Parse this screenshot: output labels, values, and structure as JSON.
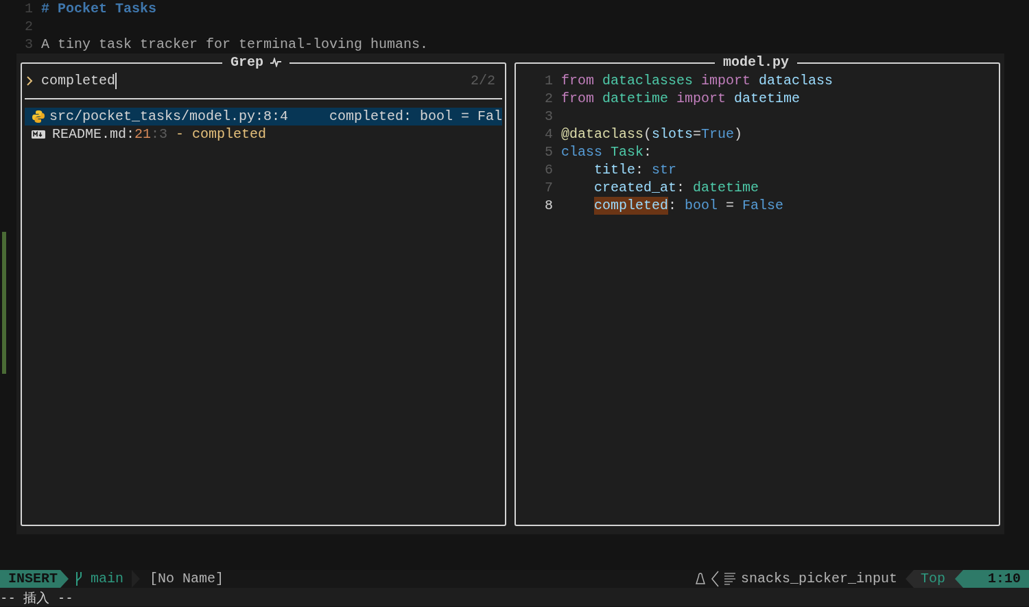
{
  "editor": {
    "lines": [
      {
        "number": "1",
        "tokens": [
          {
            "text": "# Pocket Tasks",
            "kind": "heading"
          }
        ]
      },
      {
        "number": "2"
      },
      {
        "number": "3",
        "tokens": [
          {
            "text": "A tiny task tracker for terminal-loving humans.",
            "kind": "plain"
          }
        ]
      }
    ]
  },
  "picker": {
    "title": "Grep",
    "query": "completed",
    "count": "2/2",
    "results": [
      {
        "kind": "python",
        "selected": true,
        "segments": [
          {
            "text": "src/pocket_tasks/model.py:8:4",
            "kind": "path"
          },
          {
            "text": "completed: bool = Fal",
            "kind": "match_text"
          }
        ]
      },
      {
        "kind": "markdown",
        "selected": false,
        "segments": [
          {
            "text": "README.md:",
            "kind": "path"
          },
          {
            "text": "21",
            "kind": "line"
          },
          {
            "text": ":3",
            "kind": "col"
          },
          {
            "text": " - completed",
            "kind": "preview"
          }
        ]
      }
    ]
  },
  "preview": {
    "title": "model.py",
    "lines": [
      {
        "number": "1",
        "current": false,
        "tokens": [
          {
            "text": "from ",
            "kind": "keyword"
          },
          {
            "text": "dataclasses ",
            "kind": "module"
          },
          {
            "text": "import ",
            "kind": "keyword"
          },
          {
            "text": "dataclass",
            "kind": "name"
          }
        ]
      },
      {
        "number": "2",
        "current": false,
        "tokens": [
          {
            "text": "from ",
            "kind": "keyword"
          },
          {
            "text": "datetime ",
            "kind": "module"
          },
          {
            "text": "import ",
            "kind": "keyword"
          },
          {
            "text": "datetime",
            "kind": "name"
          }
        ]
      },
      {
        "number": "3",
        "current": false
      },
      {
        "number": "4",
        "current": false,
        "tokens": [
          {
            "text": "@dataclass",
            "kind": "decorator"
          },
          {
            "text": "("
          },
          {
            "text": "slots",
            "kind": "name"
          },
          {
            "text": "="
          },
          {
            "text": "True",
            "kind": "constant"
          },
          {
            "text": ")"
          }
        ]
      },
      {
        "number": "5",
        "current": false,
        "tokens": [
          {
            "text": "class ",
            "kind": "constant"
          },
          {
            "text": "Task",
            "kind": "module"
          },
          {
            "text": ":"
          }
        ]
      },
      {
        "number": "6",
        "current": false,
        "tokens": [
          {
            "text": "    title",
            "kind": "name"
          },
          {
            "text": ": "
          },
          {
            "text": "str",
            "kind": "constant"
          }
        ]
      },
      {
        "number": "7",
        "current": false,
        "tokens": [
          {
            "text": "    created_at",
            "kind": "name"
          },
          {
            "text": ": "
          },
          {
            "text": "datetime",
            "kind": "module"
          }
        ]
      },
      {
        "number": "8",
        "current": true,
        "tokens": [
          {
            "text": "    completed",
            "kind": "match"
          },
          {
            "text": ": "
          },
          {
            "text": "bool",
            "kind": "constant"
          },
          {
            "text": " = "
          },
          {
            "text": "False",
            "kind": "constant"
          }
        ]
      }
    ]
  },
  "statusline": {
    "mode": "INSERT",
    "branch": "main",
    "file": "[No Name]",
    "filetype": "snacks_picker_input",
    "position": "Top",
    "cursor": "1:10"
  },
  "cmdline": "-- 插入 --"
}
